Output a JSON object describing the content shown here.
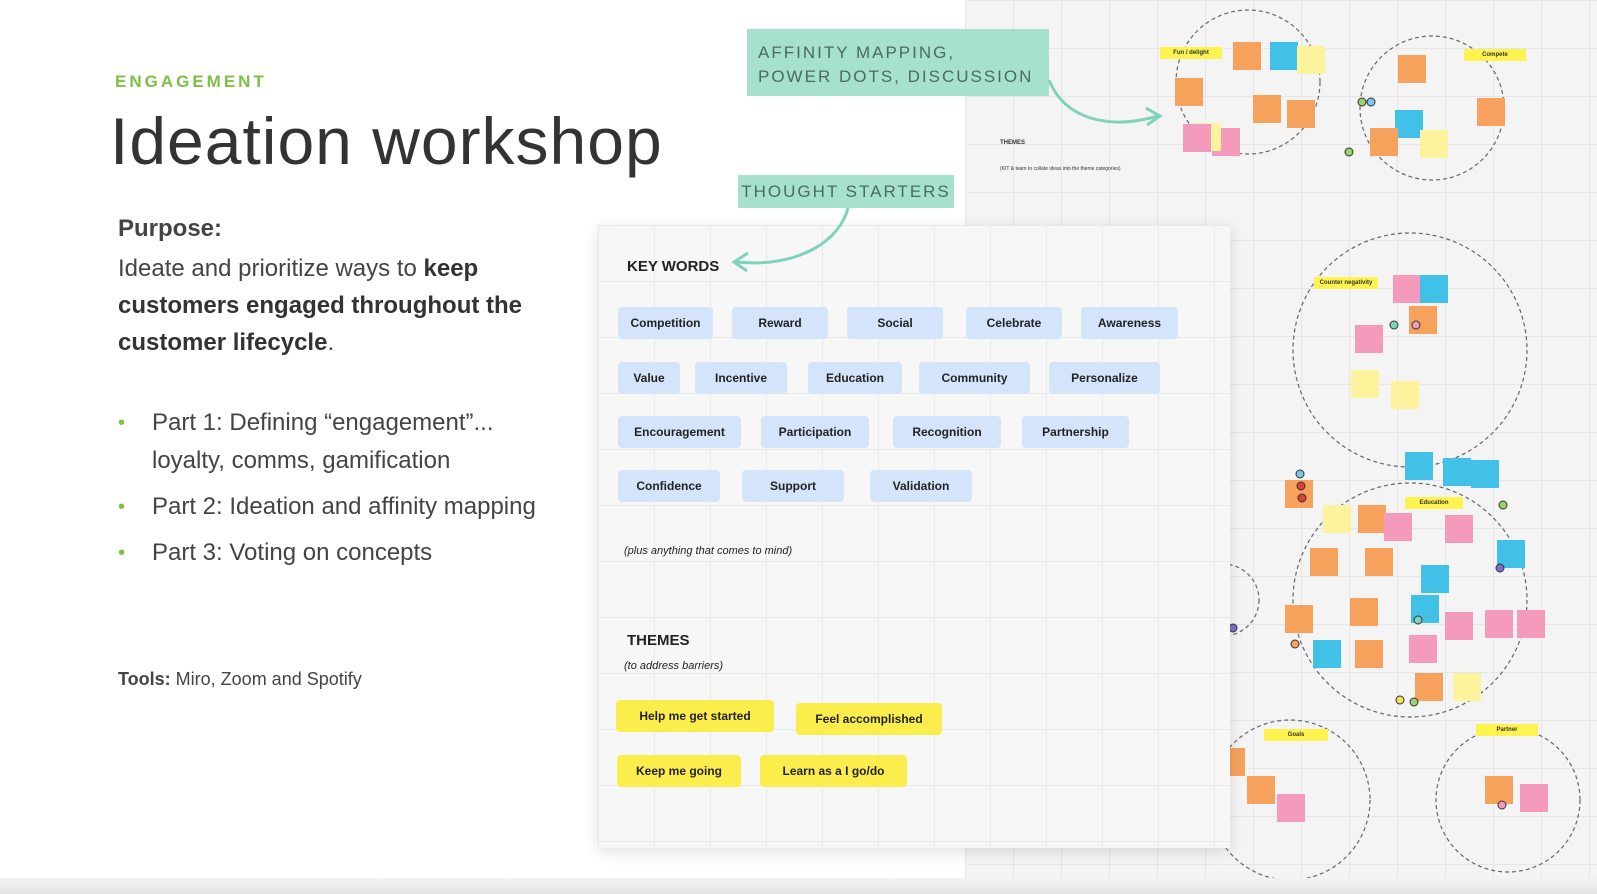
{
  "slide": {
    "eyebrow": "ENGAGEMENT",
    "title": "Ideation workshop",
    "purpose_heading": "Purpose:",
    "purpose_text_1": "Ideate and prioritize ways to ",
    "purpose_bold": "keep customers engaged throughout the customer lifecycle",
    "purpose_text_2": ".",
    "parts": [
      "Part 1: Defining “engagement”... loyalty, comms, gamification",
      "Part 2: Ideation and affinity mapping",
      "Part 3: Voting on concepts"
    ],
    "tools_label": "Tools:",
    "tools_value": "Miro, Zoom and Spotify"
  },
  "callouts": {
    "affinity_line1": "AFFINITY MAPPING,",
    "affinity_line2": "POWER DOTS, DISCUSSION",
    "thought_starters": "THOUGHT STARTERS"
  },
  "panel": {
    "key_words_heading": "KEY WORDS",
    "key_words": [
      "Competition",
      "Reward",
      "Social",
      "Celebrate",
      "Awareness",
      "Value",
      "Incentive",
      "Education",
      "Community",
      "Personalize",
      "Encouragement",
      "Participation",
      "Recognition",
      "Partnership",
      "Confidence",
      "Support",
      "Validation"
    ],
    "hint": "(plus anything that comes to mind)",
    "themes_heading": "THEMES",
    "themes_sub": "(to address barriers)",
    "themes": [
      "Help me get started",
      "Feel accomplished",
      "Keep me going",
      "Learn as a I go/do"
    ]
  },
  "board": {
    "themes_label": "THEMES",
    "themes_note": "(KIT & team to collate ideas into the theme categories)",
    "cluster_labels": [
      "Fun / delight",
      "Compete",
      "Counter negativity",
      "Education",
      "Goals",
      "Partner"
    ]
  },
  "colors": {
    "accent_green": "#7cc044",
    "callout_teal": "#a6e1cf",
    "chip_blue": "#d4e5fb",
    "chip_yellow": "#fbee4c",
    "sticky_orange": "#f6a25c",
    "sticky_pink": "#f49bbd",
    "sticky_blue": "#41c0e8",
    "sticky_yellow": "#fdf39c"
  }
}
